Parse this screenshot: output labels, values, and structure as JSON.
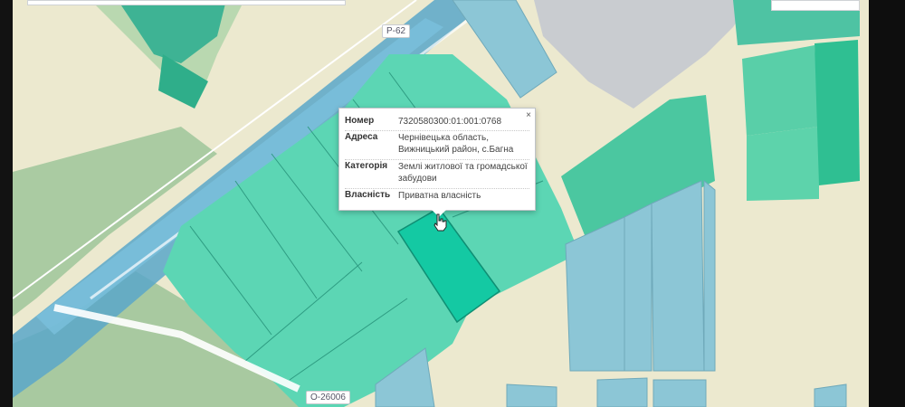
{
  "map": {
    "road_labels": [
      "P-62",
      "O-26006"
    ]
  },
  "popup": {
    "close_symbol": "×",
    "rows": [
      {
        "key": "Номер",
        "value": "7320580300:01:001:0768"
      },
      {
        "key": "Адреса",
        "value": "Чернівецька область, Вижницький район, с.Багна"
      },
      {
        "key": "Категорія",
        "value": "Землі житлової та громадської забудови"
      },
      {
        "key": "Власність",
        "value": "Приватна власність"
      }
    ]
  },
  "colors": {
    "background": "#ece9cf",
    "parcel_teal": "#55d3b0",
    "selected_parcel": "#14c9a3",
    "road_blue": "#5aa7c9",
    "forest_green": "#a8c9a0",
    "parcel_blue": "#8cc6d6"
  },
  "icons": {
    "cursor": "hand-pointer-icon",
    "close": "close-icon"
  }
}
